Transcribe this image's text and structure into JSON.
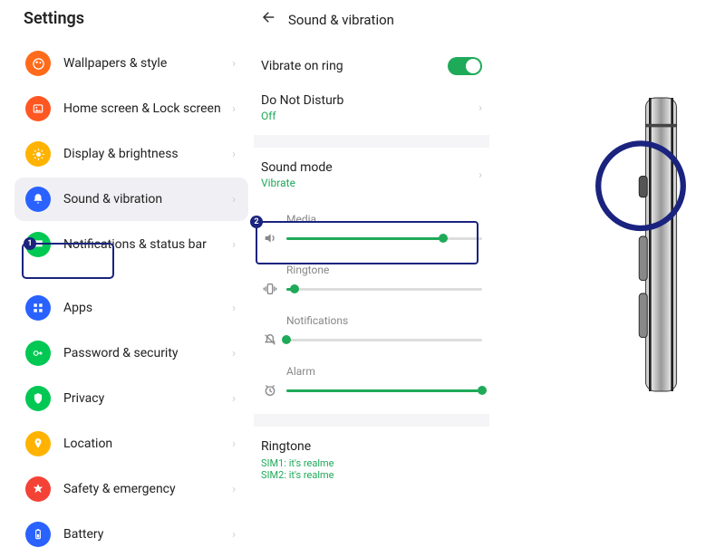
{
  "settings": {
    "title": "Settings",
    "items": [
      {
        "label": "Wallpapers & style",
        "icon": "paint",
        "color": "#ff6b1a"
      },
      {
        "label": "Home screen & Lock screen",
        "icon": "image",
        "color": "#ff5722"
      },
      {
        "label": "Display & brightness",
        "icon": "sun",
        "color": "#ffb300"
      },
      {
        "label": "Sound & vibration",
        "icon": "bell",
        "color": "#2962ff",
        "active": true
      },
      {
        "label": "Notifications & status bar",
        "icon": "chat",
        "color": "#00c853"
      },
      {
        "label": "Apps",
        "icon": "grid",
        "color": "#2962ff"
      },
      {
        "label": "Password & security",
        "icon": "key",
        "color": "#00c853"
      },
      {
        "label": "Privacy",
        "icon": "shield",
        "color": "#00c853"
      },
      {
        "label": "Location",
        "icon": "pin",
        "color": "#ffb300"
      },
      {
        "label": "Safety & emergency",
        "icon": "star",
        "color": "#f44336"
      },
      {
        "label": "Battery",
        "icon": "battery",
        "color": "#2962ff"
      }
    ]
  },
  "sound": {
    "title": "Sound & vibration",
    "vibrate_on_ring": {
      "label": "Vibrate on ring",
      "on": true
    },
    "dnd": {
      "label": "Do Not Disturb",
      "status": "Off"
    },
    "sound_mode": {
      "label": "Sound mode",
      "status": "Vibrate"
    },
    "sliders": {
      "media": {
        "label": "Media",
        "value": 80
      },
      "ringtone": {
        "label": "Ringtone",
        "value": 4
      },
      "notifications": {
        "label": "Notifications",
        "value": 0
      },
      "alarm": {
        "label": "Alarm",
        "value": 100
      }
    },
    "ringtone_section": {
      "title": "Ringtone",
      "sim1": "SIM1: it's realme",
      "sim2": "SIM2: it's realme"
    }
  },
  "annotations": {
    "badge1": "1",
    "badge2": "2"
  }
}
